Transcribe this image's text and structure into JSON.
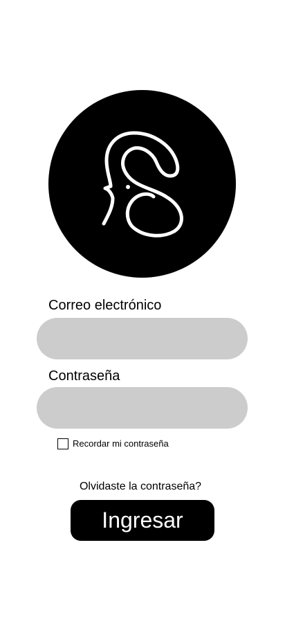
{
  "logo": {
    "icon": "elephant-s-logo-icon",
    "background_color": "#000000",
    "stroke_color": "#ffffff"
  },
  "form": {
    "email": {
      "label": "Correo electrónico",
      "value": "",
      "placeholder": ""
    },
    "password": {
      "label": "Contraseña",
      "value": "",
      "placeholder": ""
    },
    "remember": {
      "label": "Recordar mi contraseña",
      "checked": false
    },
    "forgot_password": "Olvidaste la contraseña?",
    "submit_label": "Ingresar"
  },
  "colors": {
    "input_fill": "#cccccc",
    "button_fill": "#000000",
    "button_text": "#ffffff"
  }
}
